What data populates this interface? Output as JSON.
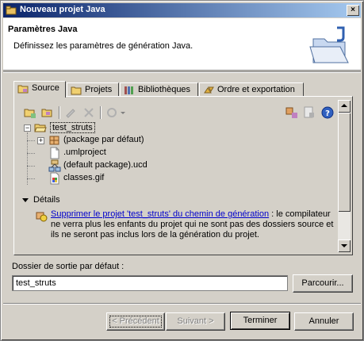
{
  "window": {
    "title": "Nouveau projet Java",
    "close_label": "×"
  },
  "header": {
    "title": "Paramètres Java",
    "description": "Définissez les paramètres de génération Java."
  },
  "tabs": [
    {
      "label": "Source",
      "icon": "source-folder-icon",
      "active": true
    },
    {
      "label": "Projets",
      "icon": "projects-icon",
      "active": false
    },
    {
      "label": "Bibliothèques",
      "icon": "libraries-icon",
      "active": false
    },
    {
      "label": "Ordre et exportation",
      "icon": "order-export-icon",
      "active": false
    }
  ],
  "toolbar": {
    "left_icons": [
      "add-folder-icon",
      "link-folder-icon",
      "edit-icon",
      "remove-icon",
      "build-path-icon"
    ],
    "right_icons": [
      "add-package-icon",
      "filter-icon",
      "help-icon"
    ]
  },
  "tree": {
    "root": "test_struts",
    "children": [
      "(package par défaut)",
      ".umlproject",
      "(default package).ucd",
      "classes.gif"
    ]
  },
  "details": {
    "label": "Détails",
    "link_text": "Supprimer le projet 'test_struts' du chemin de génération",
    "text_after_link": " : le compilateur ne verra plus les enfants du projet qui ne sont pas des dossiers source et ils ne seront pas inclus lors de la génération du projet."
  },
  "output": {
    "label": "Dossier de sortie par défaut :",
    "value": "test_struts",
    "browse_label": "Parcourir..."
  },
  "buttons": {
    "back": "< Précédent",
    "next": "Suivant >",
    "finish": "Terminer",
    "cancel": "Annuler"
  }
}
